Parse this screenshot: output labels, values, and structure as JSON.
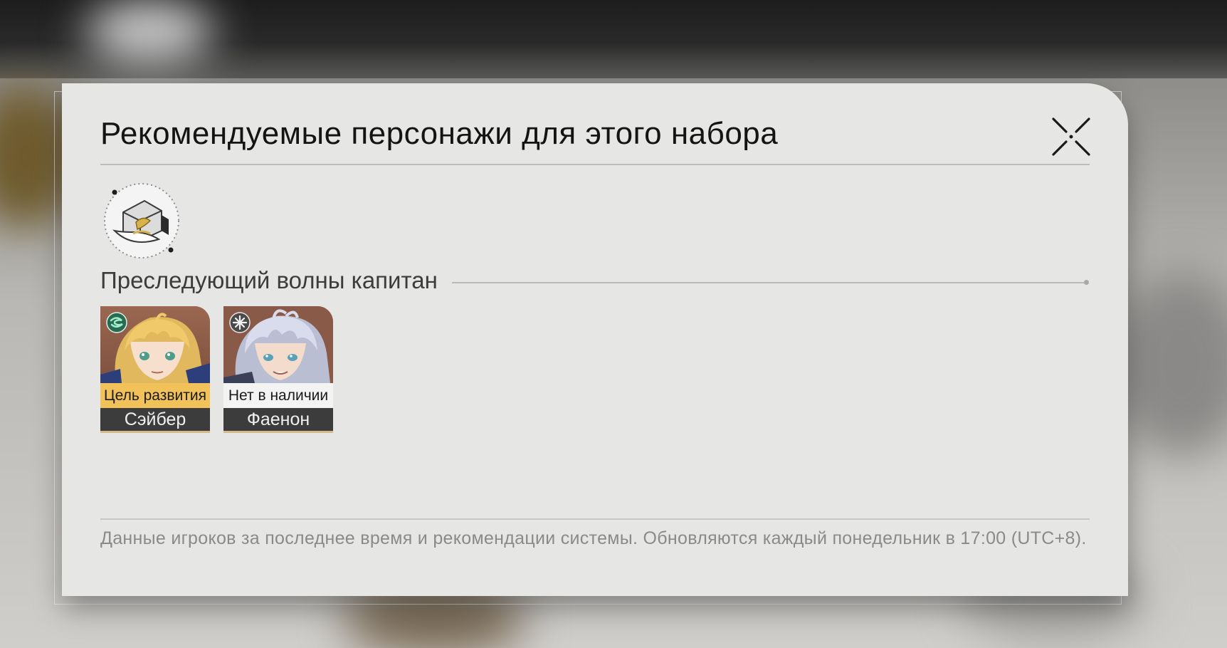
{
  "dialog": {
    "title": "Рекомендуемые персонажи для этого набора",
    "close_icon": "close-x-icon",
    "set_icon": "relic-set-hat-icon",
    "section_title": "Преследующий волны капитан",
    "characters": [
      {
        "badge": "Цель развития",
        "name": "Сэйбер",
        "element_icon": "wind-element-icon",
        "badge_color": "#f2c25a"
      },
      {
        "badge": "Нет в наличии",
        "name": "Фаенон",
        "element_icon": "physical-element-icon",
        "badge_color": "#f3f3f3"
      }
    ],
    "footnote": "Данные игроков за последнее время и рекомендации системы. Обновляются каждый понедельник в 17:00 (UTC+8)."
  }
}
